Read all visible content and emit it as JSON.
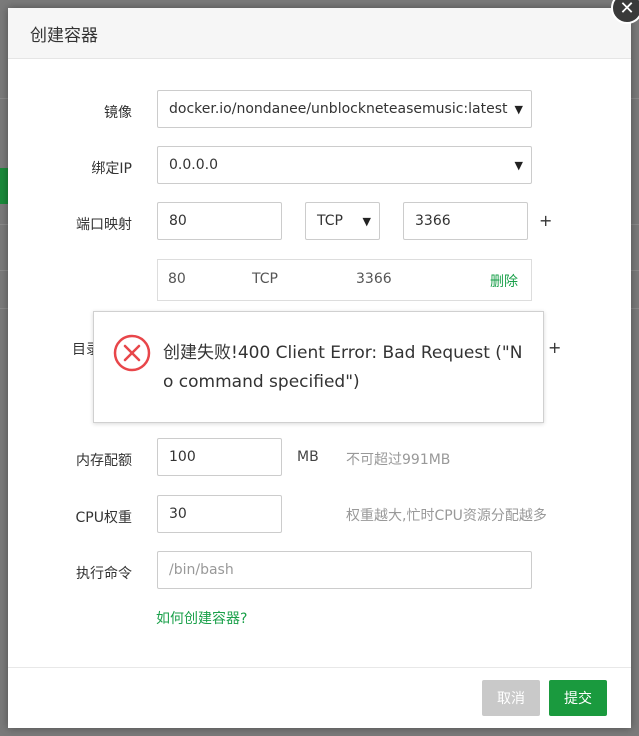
{
  "dialog": {
    "title": "创建容器",
    "close_icon": "close-icon"
  },
  "form": {
    "image": {
      "label": "镜像",
      "value": "docker.io/nondanee/unblockneteasemusic:latest"
    },
    "bind_ip": {
      "label": "绑定IP",
      "value": "0.0.0.0"
    },
    "port_mapping": {
      "label": "端口映射",
      "host_port": "80",
      "protocol": "TCP",
      "container_port": "3366",
      "add_symbol": "+",
      "existing": [
        {
          "host_port": "80",
          "protocol": "TCP",
          "container_port": "3366",
          "delete_label": "删除"
        }
      ]
    },
    "directory": {
      "label": "目录",
      "add_symbol": "+"
    },
    "memory": {
      "label": "内存配额",
      "value": "100",
      "unit": "MB",
      "hint": "不可超过991MB"
    },
    "cpu": {
      "label": "CPU权重",
      "value": "30",
      "hint": "权重越大,忙时CPU资源分配越多"
    },
    "command": {
      "label": "执行命令",
      "placeholder": "/bin/bash"
    },
    "help_link": "如何创建容器?"
  },
  "footer": {
    "cancel_label": "取消",
    "submit_label": "提交"
  },
  "toast": {
    "icon": "error-circle-icon",
    "message": "创建失败!400 Client Error: Bad Request (\"No command specified\")"
  },
  "colors": {
    "accent": "#1a9a3e",
    "error": "#e8464a",
    "cancel": "#c9c9c9"
  }
}
